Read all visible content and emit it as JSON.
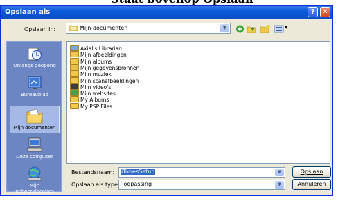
{
  "caption": "Staat bovenop Opslaan",
  "window": {
    "title": "Opslaan als",
    "help_btn": "?",
    "close_btn": "✕"
  },
  "toolbar": {
    "lookin_label": "Opslaan in:",
    "lookin_value": "Mijn documenten",
    "view_menu": "▾"
  },
  "places": [
    {
      "label": "Onlangs geopend"
    },
    {
      "label": "Bureaublad"
    },
    {
      "label": "Mijn documenten"
    },
    {
      "label": "Deze computer"
    },
    {
      "label": "Mijn netwerklocaties"
    }
  ],
  "files": [
    {
      "name": "Axialis Librarian",
      "icon": "special-folder-icon"
    },
    {
      "name": "Mijn afbeeldingen",
      "icon": "pictures-folder-icon"
    },
    {
      "name": "Mijn albums",
      "icon": "folder-icon"
    },
    {
      "name": "Mijn gegevensbronnen",
      "icon": "data-sources-folder-icon"
    },
    {
      "name": "Mijn muziek",
      "icon": "music-folder-icon"
    },
    {
      "name": "Mijn scanafbeeldingen",
      "icon": "folder-icon"
    },
    {
      "name": "Mijn video's",
      "icon": "video-folder-icon"
    },
    {
      "name": "Mijn websites",
      "icon": "web-folder-icon"
    },
    {
      "name": "My Albums",
      "icon": "folder-icon"
    },
    {
      "name": "My PSP Files",
      "icon": "folder-icon"
    }
  ],
  "form": {
    "filename_label": "Bestandsnaam:",
    "filename_value": "iTunesSetup",
    "filetype_label": "Opslaan als type:",
    "filetype_value": "Toepassing"
  },
  "buttons": {
    "save": "Opslaan",
    "cancel": "Annuleren"
  },
  "colors": {
    "title_bar": "#0a5bdb",
    "places_bar": "#6b86c3",
    "dialog_bg": "#ece9d8",
    "selection": "#316ac5"
  }
}
